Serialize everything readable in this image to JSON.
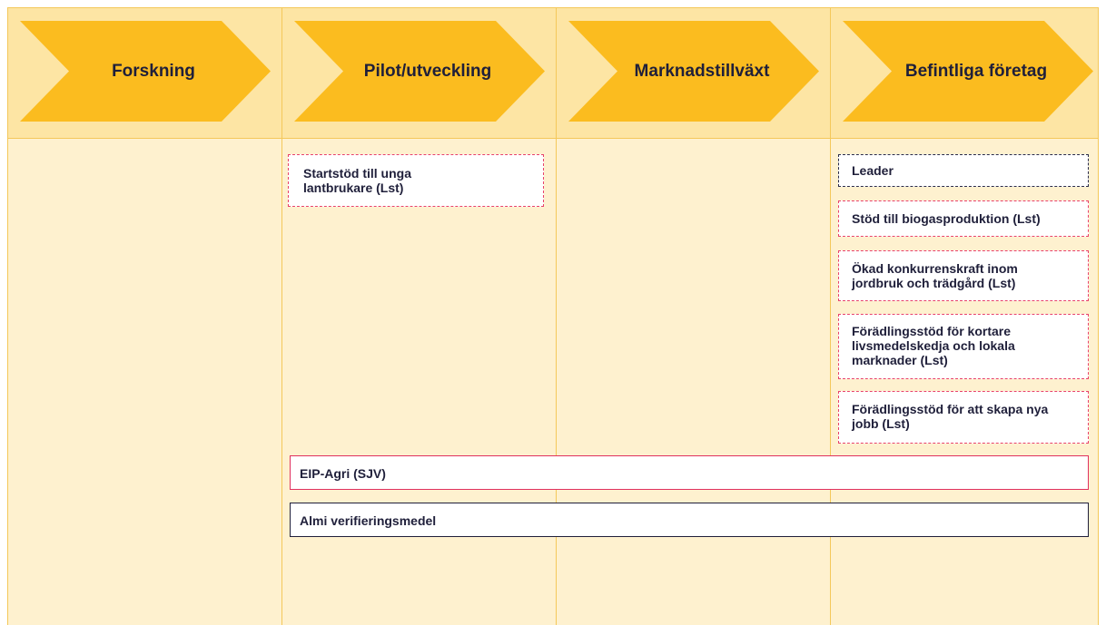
{
  "stages": [
    {
      "label": "Forskning"
    },
    {
      "label": "Pilot/utveckling"
    },
    {
      "label": "Marknadstillväxt"
    },
    {
      "label": "Befintliga företag"
    }
  ],
  "colors": {
    "stage_arrow": "#fbbc1f",
    "header_band": "#fde5a4",
    "body_band": "#fef1cf",
    "grid_line": "#f4c85a",
    "text": "#1f1f3a",
    "dashed_red": "#e8426b",
    "dashed_navy": "#2b2b4a",
    "solid_red": "#e0315e",
    "solid_navy": "#1f1f3a"
  },
  "programs": {
    "startstod": "Startstöd till unga lantbrukare (Lst)",
    "leader": "Leader",
    "biogas": "Stöd till biogasproduktion (Lst)",
    "konkurrens": "Ökad konkurrenskraft inom jordbruk och trädgård (Lst)",
    "forädling_kort": "Förädlingsstöd för kortare livsmedelskedja och lokala marknader (Lst)",
    "forädling_jobb": "Förädlingsstöd för att skapa nya jobb (Lst)",
    "eip_agri": "EIP-Agri (SJV)",
    "almi": "Almi verifieringsmedel"
  }
}
